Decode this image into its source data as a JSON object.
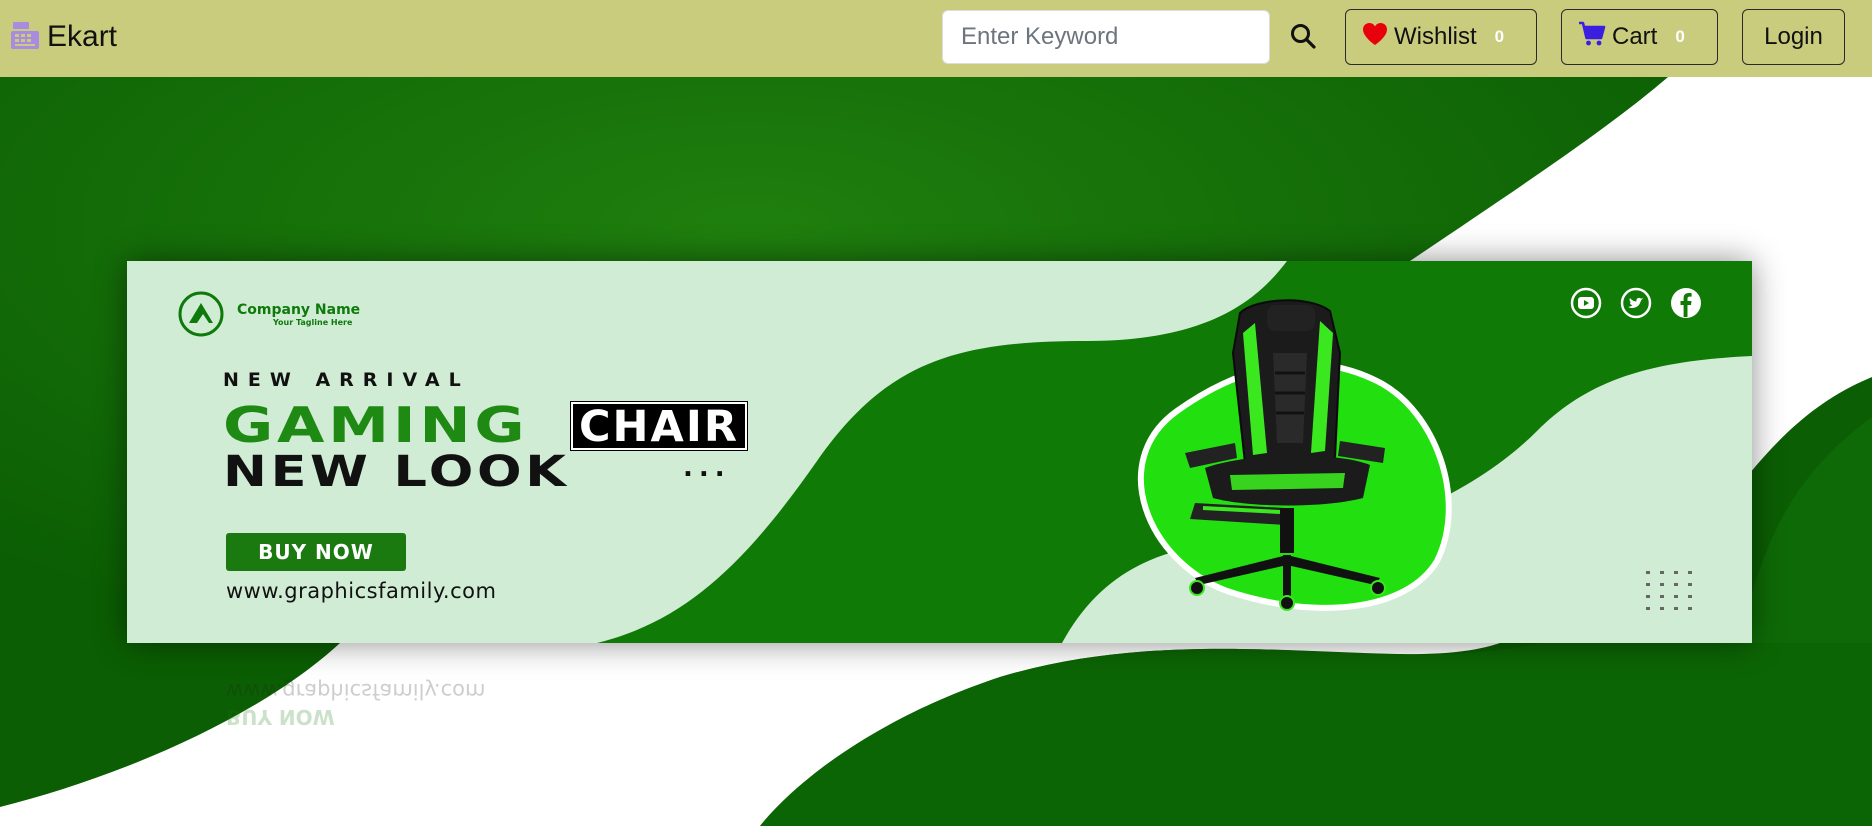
{
  "navbar": {
    "brand": "Ekart",
    "search_placeholder": "Enter Keyword",
    "wishlist": {
      "label": "Wishlist",
      "count": "0"
    },
    "cart": {
      "label": "Cart",
      "count": "0"
    },
    "login_label": "Login"
  },
  "banner": {
    "company_name": "Company Name",
    "company_tagline": "Your Tagline Here",
    "kicker": "NEW ARRIVAL",
    "headline_green": "GAMING",
    "headline_boxed": "CHAIR",
    "headline_line2": "NEW LOOK",
    "dots": "...",
    "cta_label": "BUY NOW",
    "website": "www.graphicsfamily.com",
    "socials": [
      "youtube-icon",
      "twitter-icon",
      "facebook-icon"
    ]
  },
  "colors": {
    "navbar_bg": "#c9cc7c",
    "hero_green": "#0e6a06",
    "banner_bg": "#d1ecd4",
    "accent_green": "#1a7a10",
    "bright_green": "#22e00f"
  }
}
